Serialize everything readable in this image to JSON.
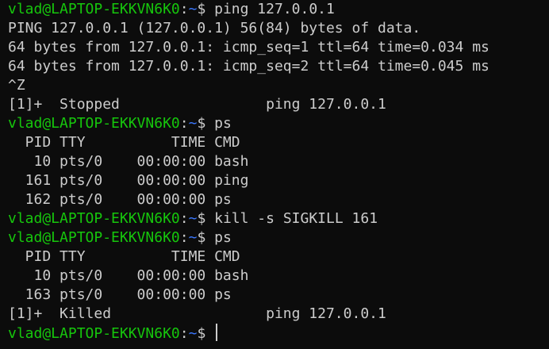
{
  "prompt": {
    "user_host": "vlad@LAPTOP-EKKVN6K0",
    "colon": ":",
    "cwd": "~",
    "symbol": "$ "
  },
  "lines": [
    {
      "type": "prompt",
      "command": "ping 127.0.0.1"
    },
    {
      "type": "output",
      "text": "PING 127.0.0.1 (127.0.0.1) 56(84) bytes of data."
    },
    {
      "type": "output",
      "text": "64 bytes from 127.0.0.1: icmp_seq=1 ttl=64 time=0.034 ms"
    },
    {
      "type": "output",
      "text": "64 bytes from 127.0.0.1: icmp_seq=2 ttl=64 time=0.045 ms"
    },
    {
      "type": "output",
      "text": "^Z"
    },
    {
      "type": "output",
      "text": "[1]+  Stopped                 ping 127.0.0.1"
    },
    {
      "type": "prompt",
      "command": "ps"
    },
    {
      "type": "output",
      "text": "  PID TTY          TIME CMD"
    },
    {
      "type": "output",
      "text": "   10 pts/0    00:00:00 bash"
    },
    {
      "type": "output",
      "text": "  161 pts/0    00:00:00 ping"
    },
    {
      "type": "output",
      "text": "  162 pts/0    00:00:00 ps"
    },
    {
      "type": "prompt",
      "command": "kill -s SIGKILL 161"
    },
    {
      "type": "prompt",
      "command": "ps"
    },
    {
      "type": "output",
      "text": "  PID TTY          TIME CMD"
    },
    {
      "type": "output",
      "text": "   10 pts/0    00:00:00 bash"
    },
    {
      "type": "output",
      "text": "  163 pts/0    00:00:00 ps"
    },
    {
      "type": "output",
      "text": "[1]+  Killed                  ping 127.0.0.1"
    },
    {
      "type": "prompt",
      "command": "",
      "cursor": true
    }
  ],
  "colors": {
    "background": "#0c0c0c",
    "foreground": "#cccccc",
    "user_host": "#16c60c",
    "cwd": "#3b78ff"
  }
}
